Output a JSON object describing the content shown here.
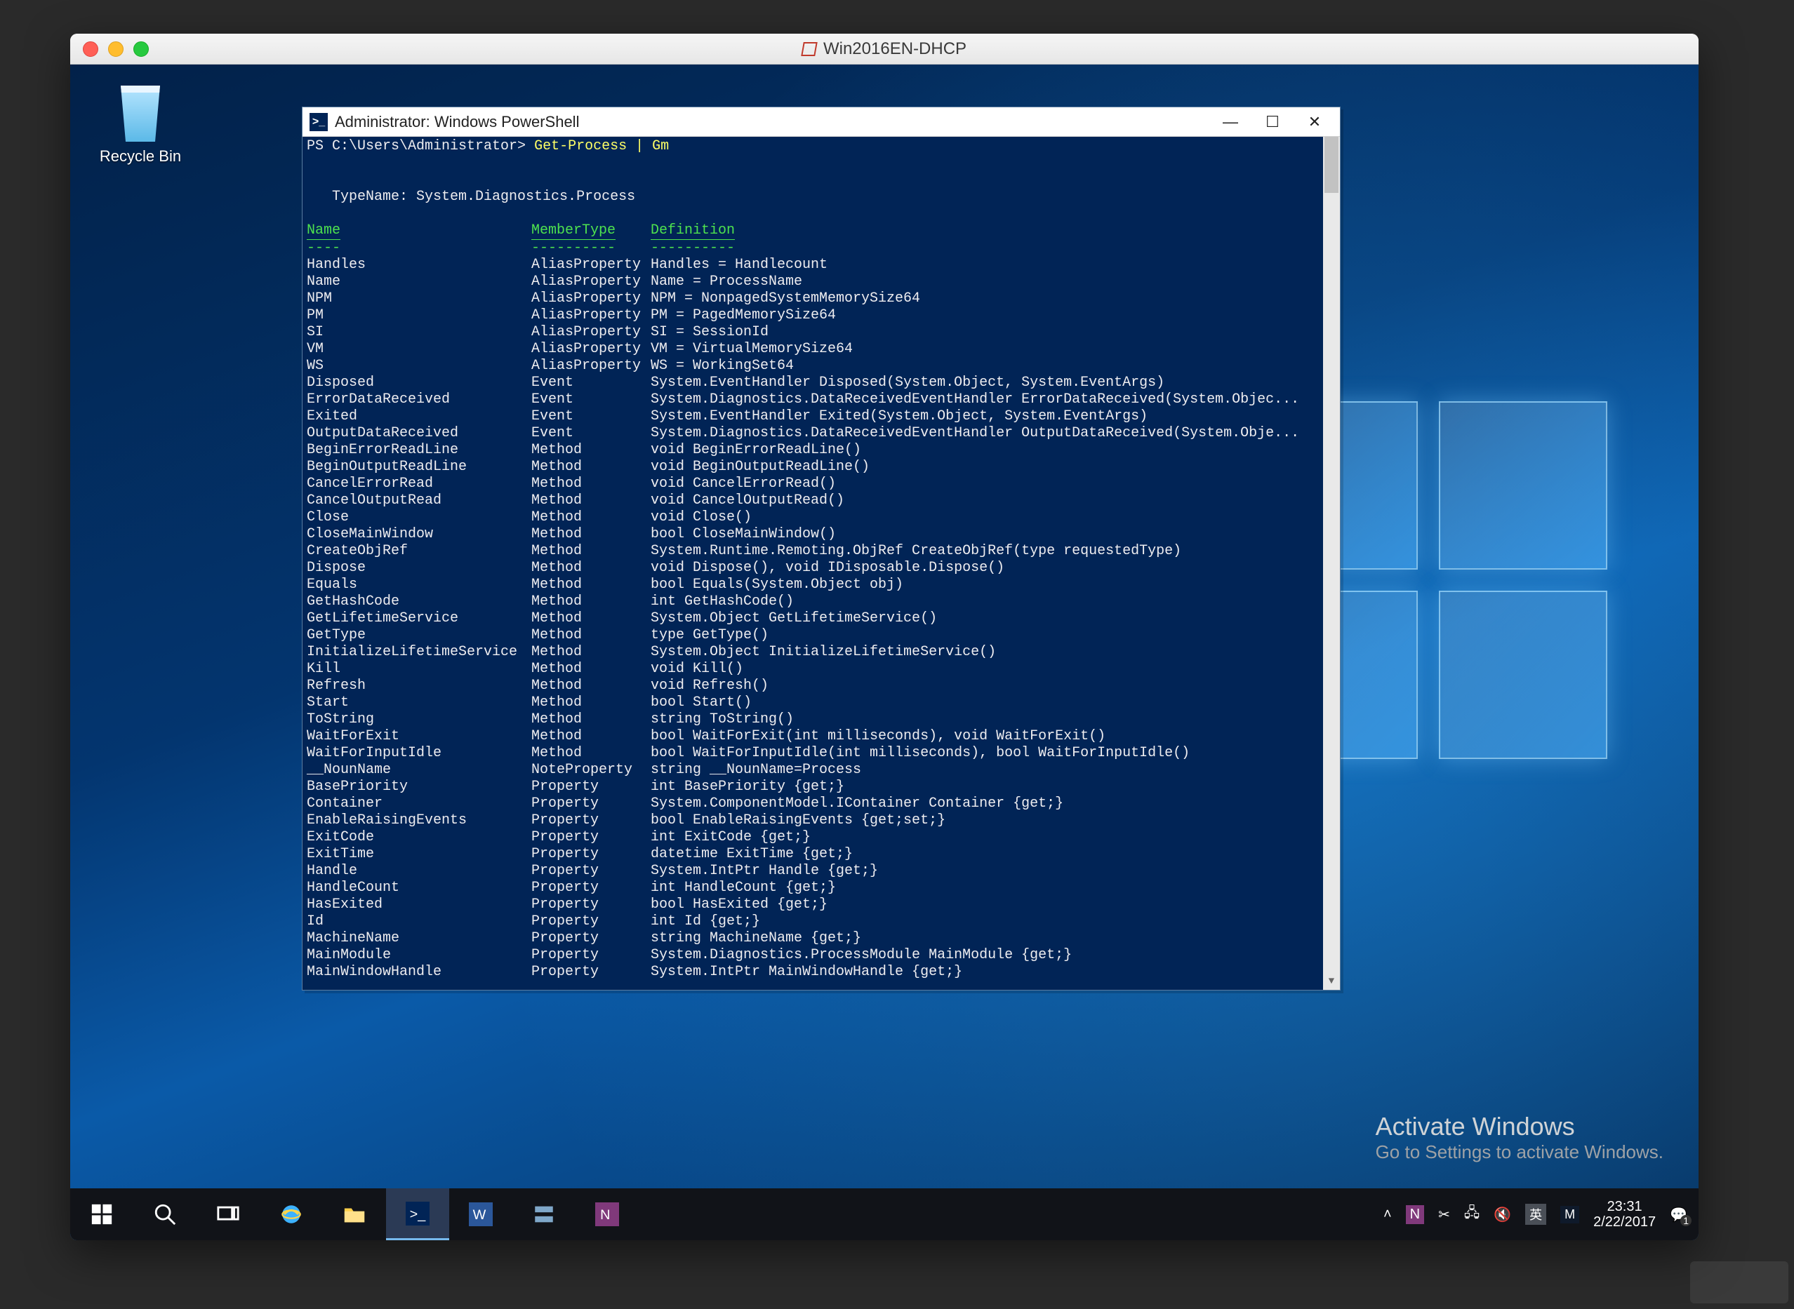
{
  "mac": {
    "title": "Win2016EN-DHCP"
  },
  "desktop": {
    "recycle_bin_label": "Recycle Bin",
    "activate_title": "Activate Windows",
    "activate_sub": "Go to Settings to activate Windows."
  },
  "powershell": {
    "title": "Administrator: Windows PowerShell",
    "prompt": "PS C:\\Users\\Administrator> ",
    "command": "Get-Process | Gm",
    "typename_line": "   TypeName: System.Diagnostics.Process",
    "headers": {
      "name": "Name",
      "membertype": "MemberType",
      "definition": "Definition"
    },
    "header_underline": {
      "name": "----",
      "membertype": "----------",
      "definition": "----------"
    },
    "rows": [
      {
        "n": "Handles",
        "t": "AliasProperty",
        "d": "Handles = Handlecount"
      },
      {
        "n": "Name",
        "t": "AliasProperty",
        "d": "Name = ProcessName"
      },
      {
        "n": "NPM",
        "t": "AliasProperty",
        "d": "NPM = NonpagedSystemMemorySize64"
      },
      {
        "n": "PM",
        "t": "AliasProperty",
        "d": "PM = PagedMemorySize64"
      },
      {
        "n": "SI",
        "t": "AliasProperty",
        "d": "SI = SessionId"
      },
      {
        "n": "VM",
        "t": "AliasProperty",
        "d": "VM = VirtualMemorySize64"
      },
      {
        "n": "WS",
        "t": "AliasProperty",
        "d": "WS = WorkingSet64"
      },
      {
        "n": "Disposed",
        "t": "Event",
        "d": "System.EventHandler Disposed(System.Object, System.EventArgs)"
      },
      {
        "n": "ErrorDataReceived",
        "t": "Event",
        "d": "System.Diagnostics.DataReceivedEventHandler ErrorDataReceived(System.Objec..."
      },
      {
        "n": "Exited",
        "t": "Event",
        "d": "System.EventHandler Exited(System.Object, System.EventArgs)"
      },
      {
        "n": "OutputDataReceived",
        "t": "Event",
        "d": "System.Diagnostics.DataReceivedEventHandler OutputDataReceived(System.Obje..."
      },
      {
        "n": "BeginErrorReadLine",
        "t": "Method",
        "d": "void BeginErrorReadLine()"
      },
      {
        "n": "BeginOutputReadLine",
        "t": "Method",
        "d": "void BeginOutputReadLine()"
      },
      {
        "n": "CancelErrorRead",
        "t": "Method",
        "d": "void CancelErrorRead()"
      },
      {
        "n": "CancelOutputRead",
        "t": "Method",
        "d": "void CancelOutputRead()"
      },
      {
        "n": "Close",
        "t": "Method",
        "d": "void Close()"
      },
      {
        "n": "CloseMainWindow",
        "t": "Method",
        "d": "bool CloseMainWindow()"
      },
      {
        "n": "CreateObjRef",
        "t": "Method",
        "d": "System.Runtime.Remoting.ObjRef CreateObjRef(type requestedType)"
      },
      {
        "n": "Dispose",
        "t": "Method",
        "d": "void Dispose(), void IDisposable.Dispose()"
      },
      {
        "n": "Equals",
        "t": "Method",
        "d": "bool Equals(System.Object obj)"
      },
      {
        "n": "GetHashCode",
        "t": "Method",
        "d": "int GetHashCode()"
      },
      {
        "n": "GetLifetimeService",
        "t": "Method",
        "d": "System.Object GetLifetimeService()"
      },
      {
        "n": "GetType",
        "t": "Method",
        "d": "type GetType()"
      },
      {
        "n": "InitializeLifetimeService",
        "t": "Method",
        "d": "System.Object InitializeLifetimeService()"
      },
      {
        "n": "Kill",
        "t": "Method",
        "d": "void Kill()"
      },
      {
        "n": "Refresh",
        "t": "Method",
        "d": "void Refresh()"
      },
      {
        "n": "Start",
        "t": "Method",
        "d": "bool Start()"
      },
      {
        "n": "ToString",
        "t": "Method",
        "d": "string ToString()"
      },
      {
        "n": "WaitForExit",
        "t": "Method",
        "d": "bool WaitForExit(int milliseconds), void WaitForExit()"
      },
      {
        "n": "WaitForInputIdle",
        "t": "Method",
        "d": "bool WaitForInputIdle(int milliseconds), bool WaitForInputIdle()"
      },
      {
        "n": "__NounName",
        "t": "NoteProperty",
        "d": "string __NounName=Process"
      },
      {
        "n": "BasePriority",
        "t": "Property",
        "d": "int BasePriority {get;}"
      },
      {
        "n": "Container",
        "t": "Property",
        "d": "System.ComponentModel.IContainer Container {get;}"
      },
      {
        "n": "EnableRaisingEvents",
        "t": "Property",
        "d": "bool EnableRaisingEvents {get;set;}"
      },
      {
        "n": "ExitCode",
        "t": "Property",
        "d": "int ExitCode {get;}"
      },
      {
        "n": "ExitTime",
        "t": "Property",
        "d": "datetime ExitTime {get;}"
      },
      {
        "n": "Handle",
        "t": "Property",
        "d": "System.IntPtr Handle {get;}"
      },
      {
        "n": "HandleCount",
        "t": "Property",
        "d": "int HandleCount {get;}"
      },
      {
        "n": "HasExited",
        "t": "Property",
        "d": "bool HasExited {get;}"
      },
      {
        "n": "Id",
        "t": "Property",
        "d": "int Id {get;}"
      },
      {
        "n": "MachineName",
        "t": "Property",
        "d": "string MachineName {get;}"
      },
      {
        "n": "MainModule",
        "t": "Property",
        "d": "System.Diagnostics.ProcessModule MainModule {get;}"
      },
      {
        "n": "MainWindowHandle",
        "t": "Property",
        "d": "System.IntPtr MainWindowHandle {get;}"
      }
    ]
  },
  "taskbar": {
    "items": [
      "start",
      "search",
      "task-view",
      "ie",
      "file-explorer",
      "powershell",
      "word",
      "server-manager",
      "onenote"
    ],
    "tray": {
      "up": "˄",
      "onenote_badge": "N",
      "scissors": "✂",
      "network": "🖧",
      "volume": "🔇",
      "ime_lang": "英",
      "ime_mode": "M",
      "time": "23:31",
      "date": "2/22/2017",
      "action_center": "💬",
      "action_count": "1"
    }
  }
}
